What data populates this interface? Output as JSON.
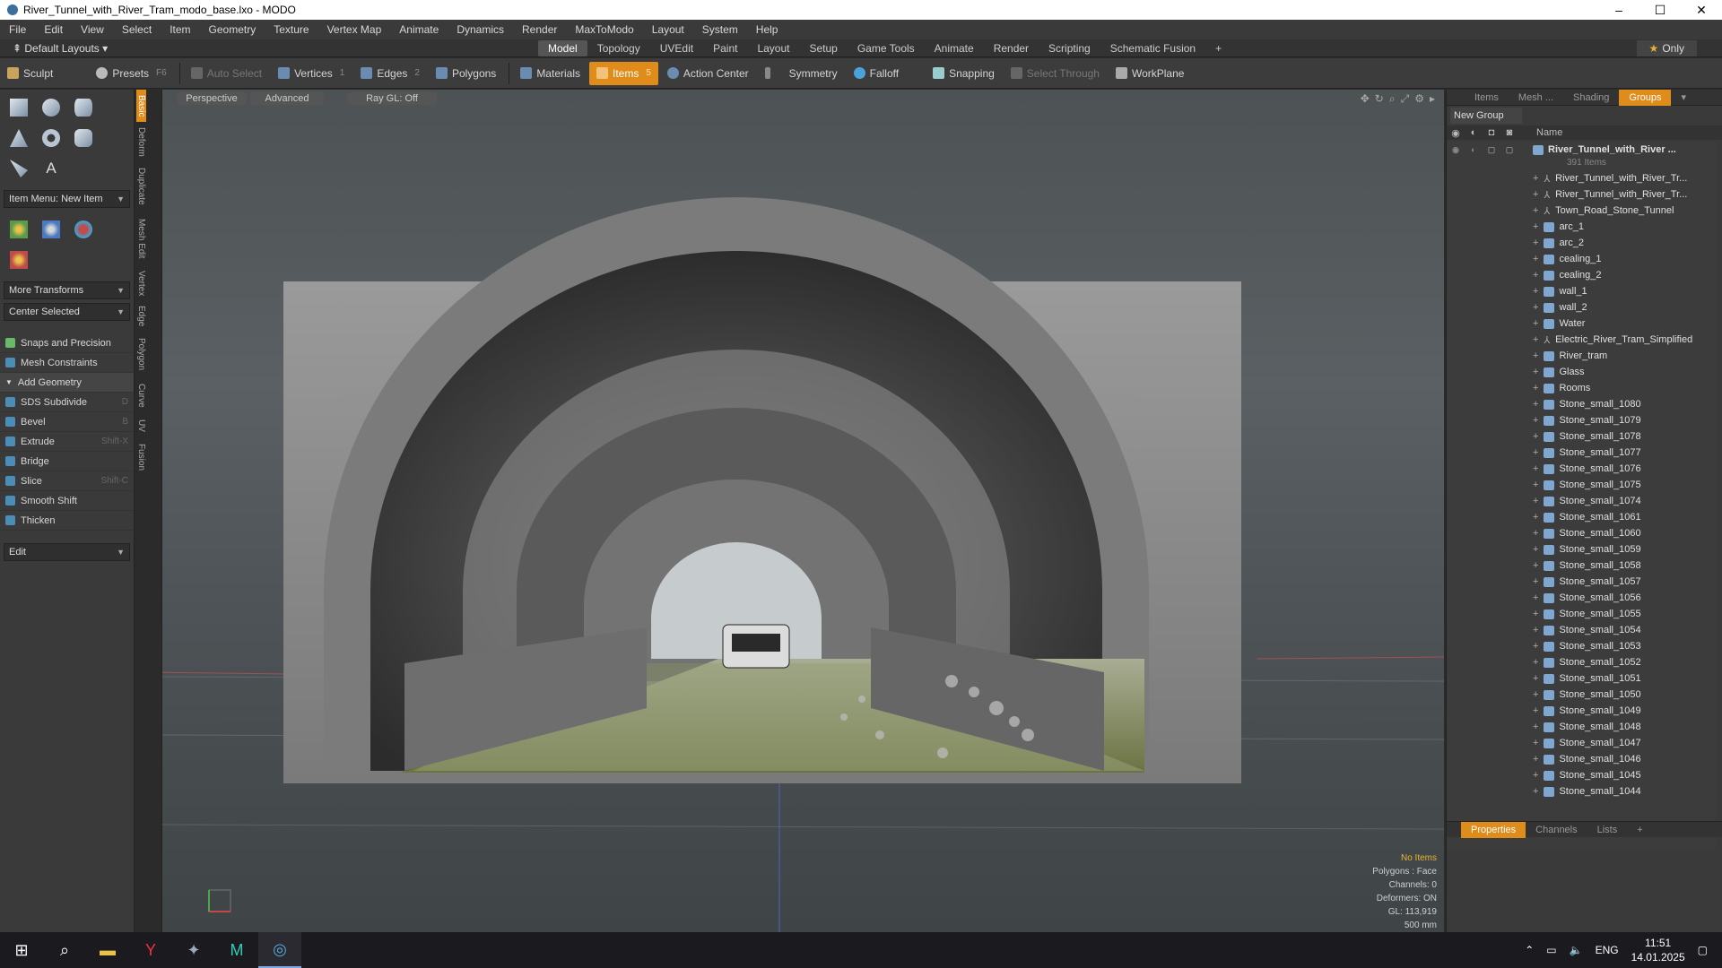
{
  "window": {
    "title": "River_Tunnel_with_River_Tram_modo_base.lxo - MODO"
  },
  "menu": [
    "File",
    "Edit",
    "View",
    "Select",
    "Item",
    "Geometry",
    "Texture",
    "Vertex Map",
    "Animate",
    "Dynamics",
    "Render",
    "MaxToModo",
    "Layout",
    "System",
    "Help"
  ],
  "layout": {
    "selector": "Default Layouts",
    "only_label": "Only"
  },
  "mode_tabs": [
    "Model",
    "Topology",
    "UVEdit",
    "Paint",
    "Layout",
    "Setup",
    "Game Tools",
    "Animate",
    "Render",
    "Scripting",
    "Schematic Fusion"
  ],
  "mode_tabs_active": "Model",
  "toolbar": {
    "sculpt": "Sculpt",
    "presets": "Presets",
    "presets_key": "F6",
    "auto_select": "Auto Select",
    "vertices": "Vertices",
    "vertices_count": "1",
    "edges": "Edges",
    "edges_count": "2",
    "polygons": "Polygons",
    "materials": "Materials",
    "items": "Items",
    "items_count": "5",
    "action_center": "Action Center",
    "symmetry": "Symmetry",
    "falloff": "Falloff",
    "snapping": "Snapping",
    "select_through": "Select Through",
    "workplane": "WorkPlane"
  },
  "left_panel": {
    "item_menu": "Item Menu: New Item",
    "more_transforms": "More Transforms",
    "center_selected": "Center Selected",
    "tools": [
      {
        "label": "Snaps and Precision",
        "key": ""
      },
      {
        "label": "Mesh Constraints",
        "key": ""
      },
      {
        "label": "Add Geometry",
        "key": "",
        "header": true
      },
      {
        "label": "SDS Subdivide",
        "key": "D"
      },
      {
        "label": "Bevel",
        "key": "B"
      },
      {
        "label": "Extrude",
        "key": "Shift-X"
      },
      {
        "label": "Bridge",
        "key": ""
      },
      {
        "label": "Slice",
        "key": "Shift-C"
      },
      {
        "label": "Smooth Shift",
        "key": ""
      },
      {
        "label": "Thicken",
        "key": ""
      }
    ],
    "edit": "Edit",
    "vertical_tabs": [
      "Basic",
      "Deform",
      "Duplicate",
      "Mesh Edit",
      "Vertex",
      "Edge",
      "Polygon",
      "Curve",
      "UV",
      "Fusion"
    ]
  },
  "viewport": {
    "tabs": [
      "Perspective",
      "Advanced",
      "Ray GL: Off"
    ],
    "status": [
      "No Items",
      "Polygons : Face",
      "Channels: 0",
      "Deformers: ON",
      "GL: 113,919",
      "500 mm"
    ]
  },
  "right_panel": {
    "tabs": [
      "Items",
      "Mesh ...",
      "Shading",
      "Groups"
    ],
    "active_tab": "Groups",
    "new_group": "New Group",
    "name_header": "Name",
    "root": "River_Tunnel_with_River ...",
    "root_count": "391 Items",
    "items": [
      {
        "name": "River_Tunnel_with_River_Tr...",
        "type": "loc"
      },
      {
        "name": "River_Tunnel_with_River_Tr...",
        "type": "loc"
      },
      {
        "name": "Town_Road_Stone_Tunnel",
        "type": "loc"
      },
      {
        "name": "arc_1",
        "type": "mesh"
      },
      {
        "name": "arc_2",
        "type": "mesh"
      },
      {
        "name": "cealing_1",
        "type": "mesh"
      },
      {
        "name": "cealing_2",
        "type": "mesh"
      },
      {
        "name": "wall_1",
        "type": "mesh"
      },
      {
        "name": "wall_2",
        "type": "mesh"
      },
      {
        "name": "Water",
        "type": "mesh"
      },
      {
        "name": "Electric_River_Tram_Simplified",
        "type": "loc"
      },
      {
        "name": "River_tram",
        "type": "mesh"
      },
      {
        "name": "Glass",
        "type": "mesh"
      },
      {
        "name": "Rooms",
        "type": "mesh"
      },
      {
        "name": "Stone_small_1080",
        "type": "mesh"
      },
      {
        "name": "Stone_small_1079",
        "type": "mesh"
      },
      {
        "name": "Stone_small_1078",
        "type": "mesh"
      },
      {
        "name": "Stone_small_1077",
        "type": "mesh"
      },
      {
        "name": "Stone_small_1076",
        "type": "mesh"
      },
      {
        "name": "Stone_small_1075",
        "type": "mesh"
      },
      {
        "name": "Stone_small_1074",
        "type": "mesh"
      },
      {
        "name": "Stone_small_1061",
        "type": "mesh"
      },
      {
        "name": "Stone_small_1060",
        "type": "mesh"
      },
      {
        "name": "Stone_small_1059",
        "type": "mesh"
      },
      {
        "name": "Stone_small_1058",
        "type": "mesh"
      },
      {
        "name": "Stone_small_1057",
        "type": "mesh"
      },
      {
        "name": "Stone_small_1056",
        "type": "mesh"
      },
      {
        "name": "Stone_small_1055",
        "type": "mesh"
      },
      {
        "name": "Stone_small_1054",
        "type": "mesh"
      },
      {
        "name": "Stone_small_1053",
        "type": "mesh"
      },
      {
        "name": "Stone_small_1052",
        "type": "mesh"
      },
      {
        "name": "Stone_small_1051",
        "type": "mesh"
      },
      {
        "name": "Stone_small_1050",
        "type": "mesh"
      },
      {
        "name": "Stone_small_1049",
        "type": "mesh"
      },
      {
        "name": "Stone_small_1048",
        "type": "mesh"
      },
      {
        "name": "Stone_small_1047",
        "type": "mesh"
      },
      {
        "name": "Stone_small_1046",
        "type": "mesh"
      },
      {
        "name": "Stone_small_1045",
        "type": "mesh"
      },
      {
        "name": "Stone_small_1044",
        "type": "mesh"
      }
    ],
    "bottom_tabs": [
      "Properties",
      "Channels",
      "Lists"
    ]
  },
  "taskbar": {
    "lang": "ENG",
    "time": "11:51",
    "date": "14.01.2025"
  }
}
